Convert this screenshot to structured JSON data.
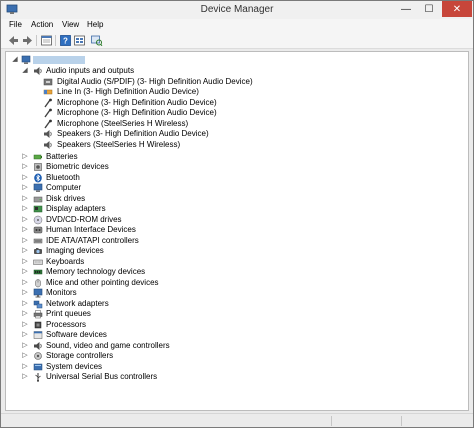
{
  "window": {
    "title": "Device Manager",
    "min_glyph": "—",
    "max_glyph": "☐",
    "close_glyph": "✕"
  },
  "menu": {
    "file": "File",
    "action": "Action",
    "view": "View",
    "help": "Help"
  },
  "toolbar": {
    "icons": [
      "back-arrow-icon",
      "forward-arrow-icon",
      "properties-icon",
      "help-icon",
      "grid-view-icon",
      "scan-hardware-icon"
    ]
  },
  "tree": {
    "root": {
      "label": "",
      "expanded": true
    },
    "audio_group": {
      "label": "Audio inputs and outputs",
      "expanded": true,
      "children": [
        "Digital Audio (S/PDIF) (3- High Definition Audio Device)",
        "Line In (3- High Definition Audio Device)",
        "Microphone (3- High Definition Audio Device)",
        "Microphone (3- High Definition Audio Device)",
        "Microphone (SteelSeries H Wireless)",
        "Speakers (3- High Definition Audio Device)",
        "Speakers (SteelSeries H Wireless)"
      ]
    },
    "categories": [
      "Batteries",
      "Biometric devices",
      "Bluetooth",
      "Computer",
      "Disk drives",
      "Display adapters",
      "DVD/CD-ROM drives",
      "Human Interface Devices",
      "IDE ATA/ATAPI controllers",
      "Imaging devices",
      "Keyboards",
      "Memory technology devices",
      "Mice and other pointing devices",
      "Monitors",
      "Network adapters",
      "Print queues",
      "Processors",
      "Software devices",
      "Sound, video and game controllers",
      "Storage controllers",
      "System devices",
      "Universal Serial Bus controllers"
    ]
  },
  "colors": {
    "accent_close": "#c7463a",
    "selection": "#b9d2ea"
  }
}
